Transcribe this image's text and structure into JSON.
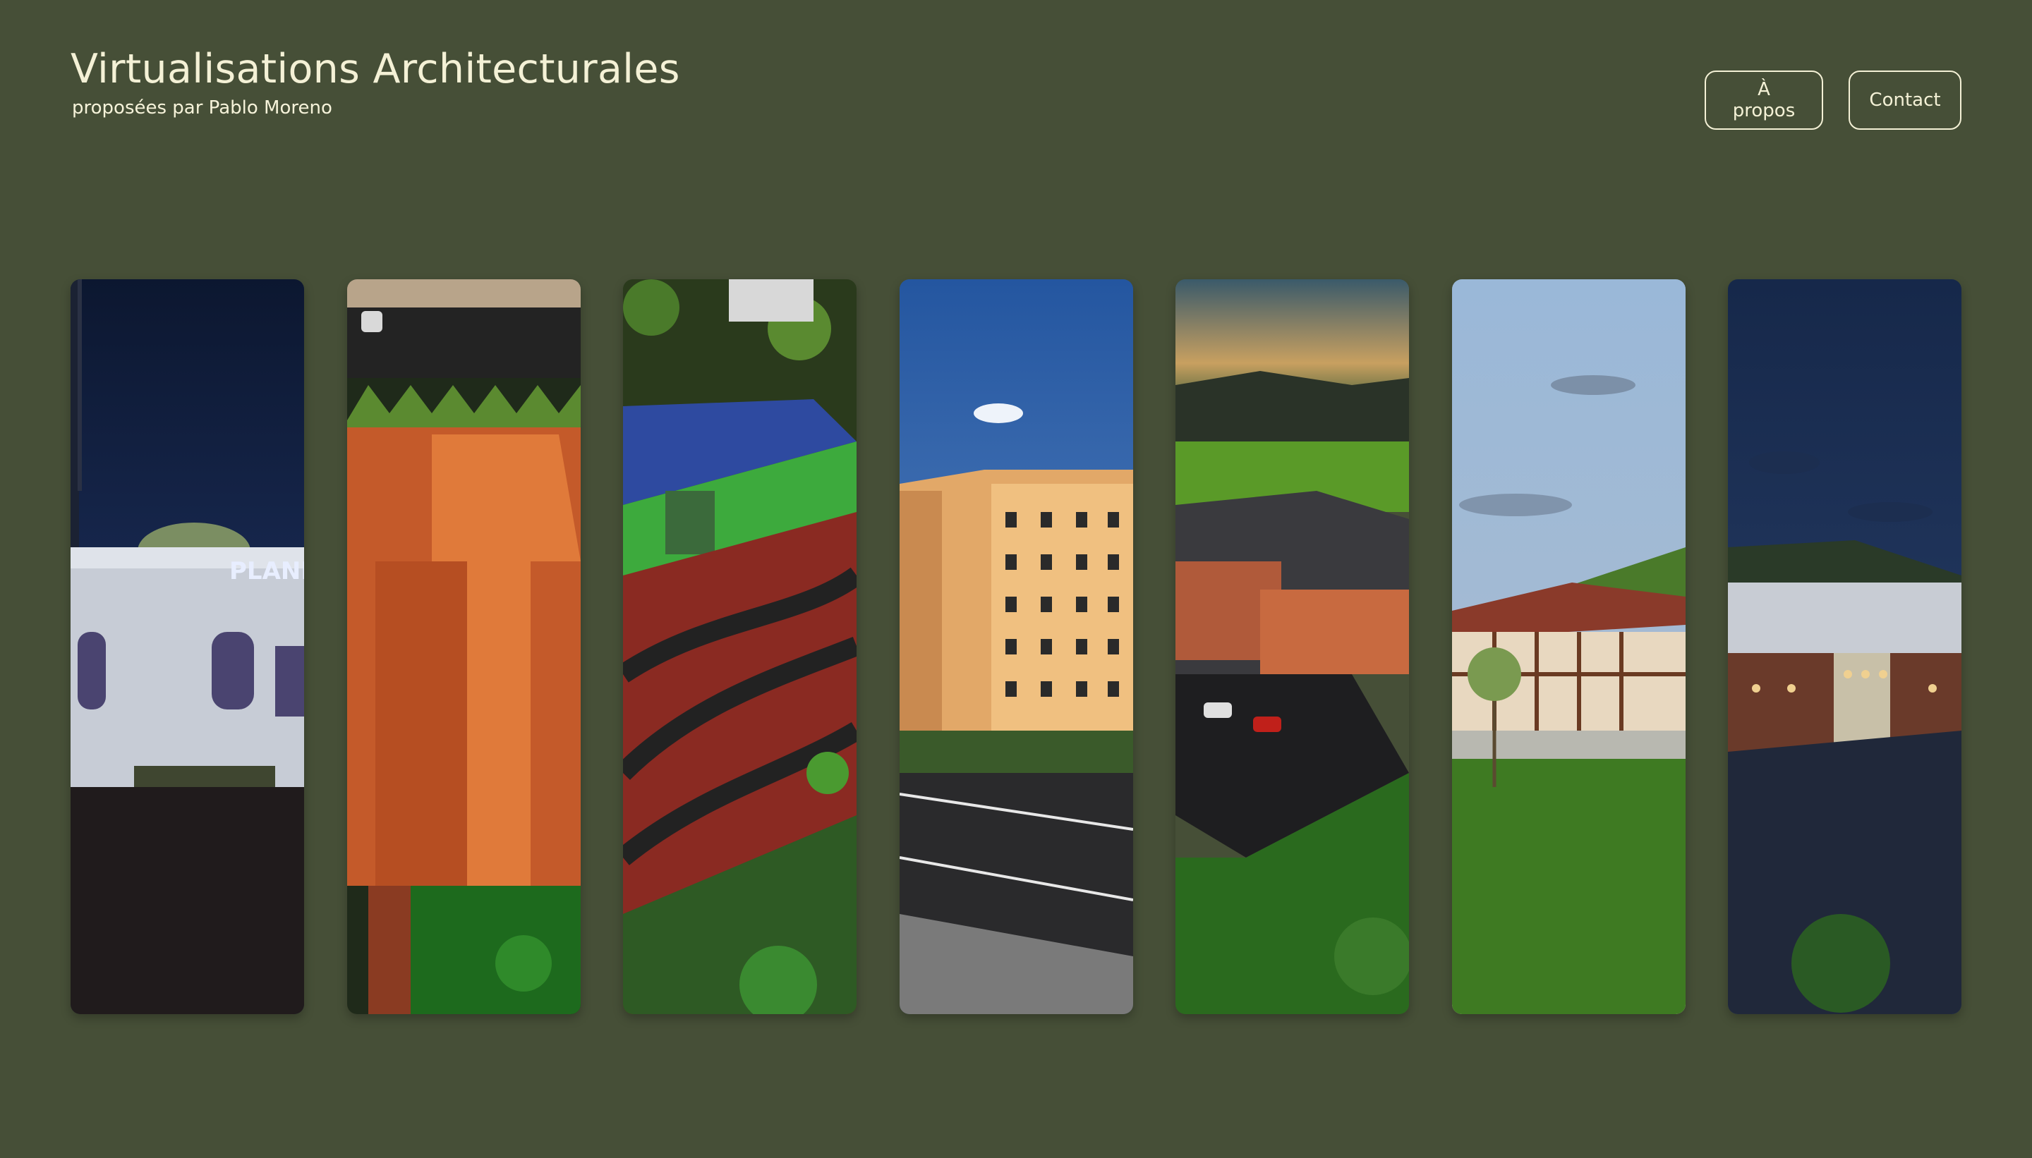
{
  "header": {
    "title": "Virtualisations Architecturales",
    "subtitle": "proposées par Pablo Moreno"
  },
  "nav": {
    "about_label": "À propos",
    "contact_label": "Contact"
  },
  "gallery": {
    "panels": [
      {
        "scene": "planetarium-night",
        "sign_text": "PLANET"
      },
      {
        "scene": "orange-roof-aerial"
      },
      {
        "scene": "sports-hall-tracks"
      },
      {
        "scene": "apartment-street-day"
      },
      {
        "scene": "campus-sunset-parking"
      },
      {
        "scene": "timber-house-meadow"
      },
      {
        "scene": "hall-night-lights"
      }
    ]
  },
  "colors": {
    "background": "#464f37",
    "text": "#f4f1d6"
  }
}
